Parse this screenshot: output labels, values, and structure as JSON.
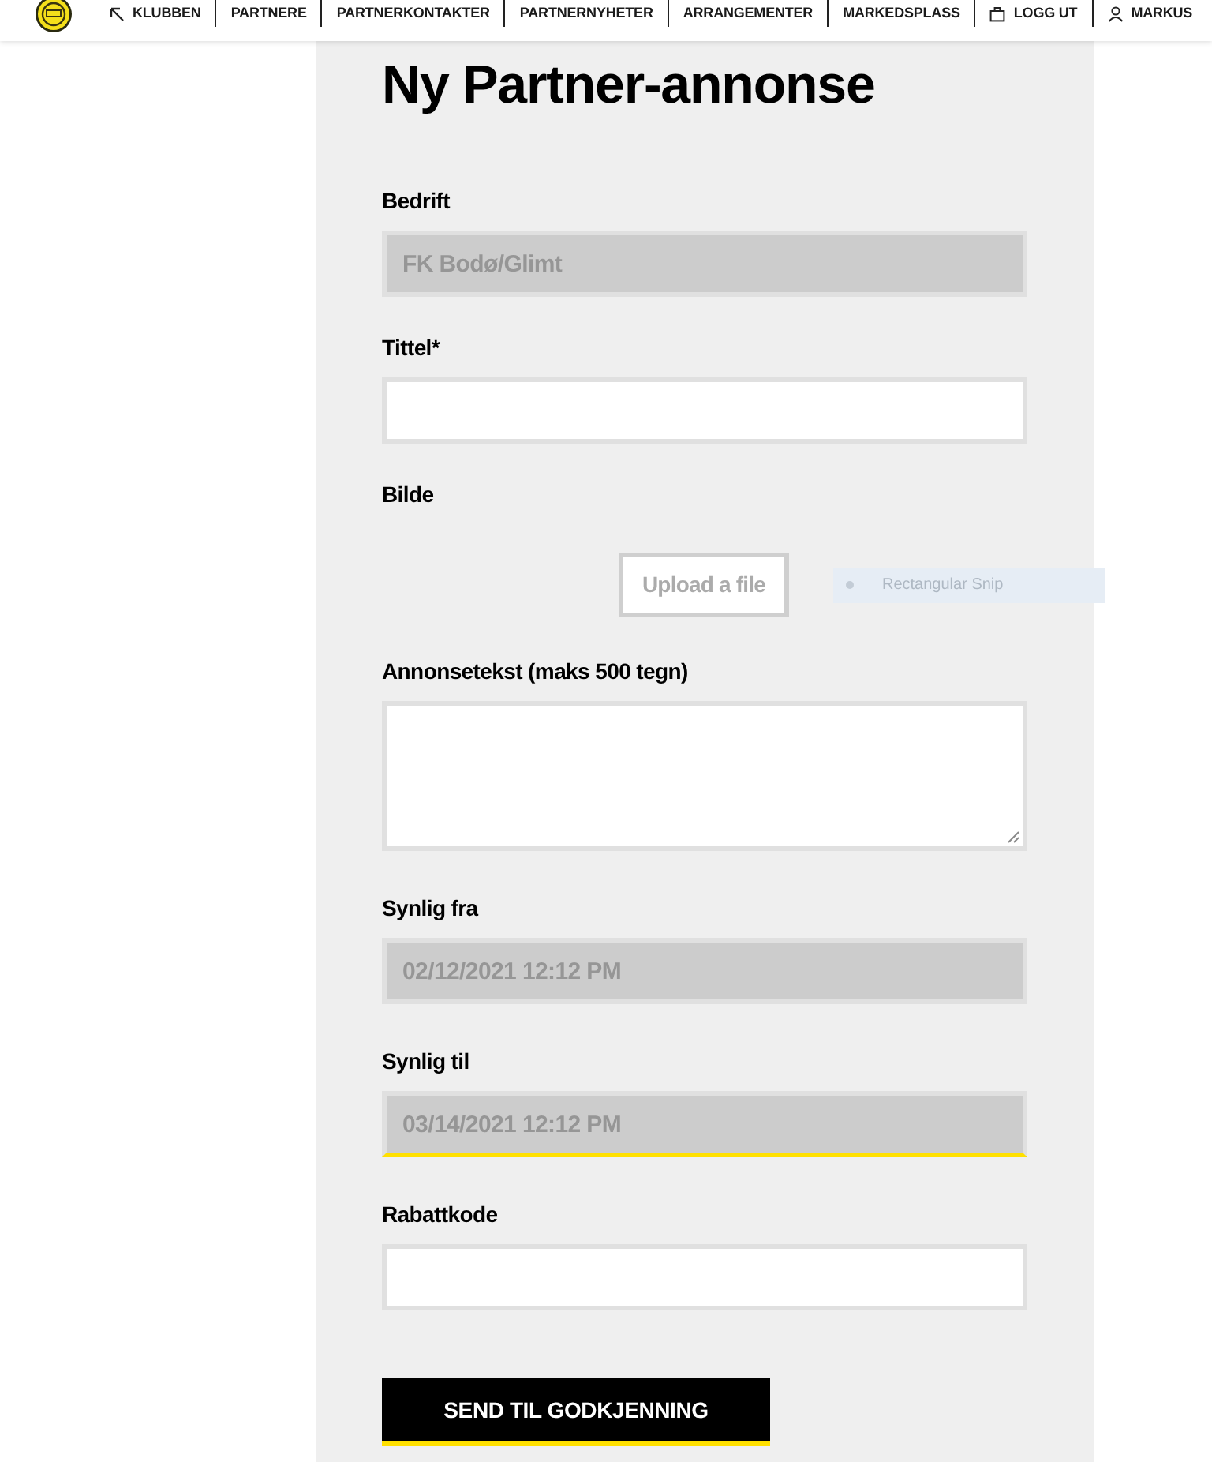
{
  "nav": {
    "items": [
      {
        "kind": "back",
        "label": "KLUBBEN"
      },
      {
        "kind": "link",
        "label": "PARTNERE"
      },
      {
        "kind": "link",
        "label": "PARTNERKONTAKTER"
      },
      {
        "kind": "link",
        "label": "PARTNERNYHETER"
      },
      {
        "kind": "link",
        "label": "ARRANGEMENTER"
      },
      {
        "kind": "link",
        "label": "MARKEDSPLASS"
      },
      {
        "kind": "logout",
        "label": "LOGG UT"
      },
      {
        "kind": "profile",
        "label": "MARKUS"
      }
    ]
  },
  "form": {
    "title": "Ny Partner-annonse",
    "fields": [
      {
        "kind": "text",
        "label": "Bedrift",
        "value": "FK Bodø/Glimt",
        "disabled": true,
        "focused": false
      },
      {
        "kind": "text",
        "label": "Tittel*",
        "disabled": false,
        "focused": false
      },
      {
        "kind": "file",
        "label": "Bilde",
        "button": "Upload a file",
        "files": [
          "Rectangular Snip"
        ],
        "disabled": false,
        "focused": false
      },
      {
        "kind": "textarea",
        "label": "Annonsetekst (maks 500 tegn)",
        "disabled": false,
        "focused": false
      },
      {
        "kind": "text",
        "label": "Synlig fra",
        "value": "02/12/2021 12:12 PM",
        "disabled": true,
        "focused": false
      },
      {
        "kind": "text",
        "label": "Synlig til",
        "value": "03/14/2021 12:12 PM",
        "disabled": true,
        "focused": true
      },
      {
        "kind": "text",
        "label": "Rabattkode",
        "disabled": false,
        "focused": false
      }
    ],
    "submit": "SEND TIL GODKJENNING"
  }
}
